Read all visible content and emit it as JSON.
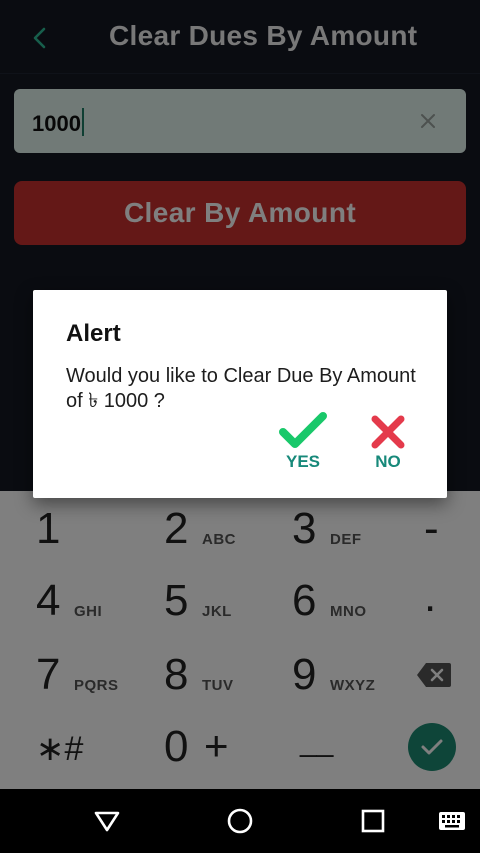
{
  "header": {
    "title": "Clear Dues By Amount",
    "back_icon": "chevron-left-icon"
  },
  "amount_field": {
    "value": "1000",
    "clear_icon": "close-icon"
  },
  "clear_button": {
    "label": "Clear By Amount"
  },
  "dialog": {
    "title": "Alert",
    "message": "Would you like to Clear Due By Amount of ৳ 1000 ?",
    "yes_label": "YES",
    "no_label": "NO"
  },
  "keyboard": {
    "keys": [
      {
        "num": "1",
        "letters": ""
      },
      {
        "num": "2",
        "letters": "ABC"
      },
      {
        "num": "3",
        "letters": "DEF"
      },
      {
        "num": "4",
        "letters": "GHI"
      },
      {
        "num": "5",
        "letters": "JKL"
      },
      {
        "num": "6",
        "letters": "MNO"
      },
      {
        "num": "7",
        "letters": "PQRS"
      },
      {
        "num": "8",
        "letters": "TUV"
      },
      {
        "num": "9",
        "letters": "WXYZ"
      },
      {
        "num": "0",
        "letters": "+"
      }
    ],
    "symbols": {
      "minus": "-",
      "period": ".",
      "star_hash": "∗#",
      "space": "__"
    }
  },
  "colors": {
    "accent": "#1c8a72",
    "danger": "#c9302f",
    "yes_check": "#19c86a",
    "no_x": "#e43a4b"
  }
}
